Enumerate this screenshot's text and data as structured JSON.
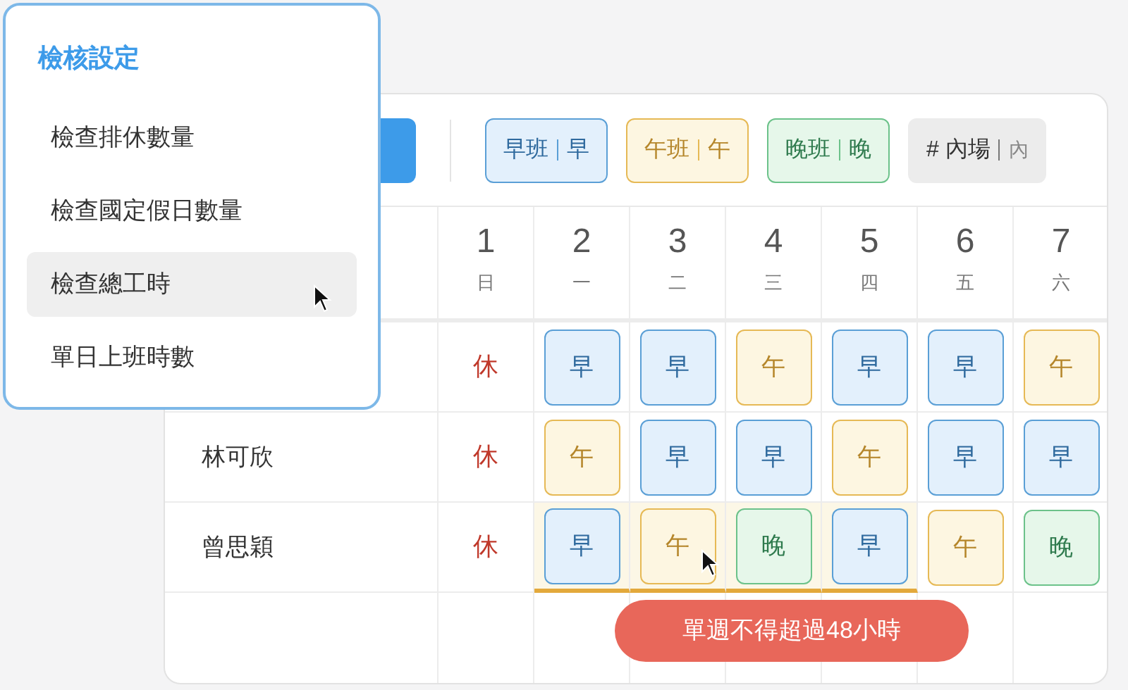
{
  "menu": {
    "title": "檢核設定",
    "items": [
      {
        "label": "檢查排休數量",
        "selected": false
      },
      {
        "label": "檢查國定假日數量",
        "selected": false
      },
      {
        "label": "檢查總工時",
        "selected": true
      },
      {
        "label": "單日上班時數",
        "selected": false
      }
    ]
  },
  "legend": [
    {
      "kind": "early",
      "name": "早班",
      "code": "早"
    },
    {
      "kind": "afternoon",
      "name": "午班",
      "code": "午"
    },
    {
      "kind": "evening",
      "name": "晚班",
      "code": "晚"
    },
    {
      "kind": "area",
      "name": "# 內場",
      "code": "內"
    }
  ],
  "days": [
    {
      "date": "1",
      "weekday": "日"
    },
    {
      "date": "2",
      "weekday": "一"
    },
    {
      "date": "3",
      "weekday": "二"
    },
    {
      "date": "4",
      "weekday": "三"
    },
    {
      "date": "5",
      "weekday": "四"
    },
    {
      "date": "6",
      "weekday": "五"
    },
    {
      "date": "7",
      "weekday": "六"
    }
  ],
  "rows": [
    {
      "cells": [
        {
          "kind": "off",
          "text": "休",
          "flagged": false
        },
        {
          "kind": "early",
          "text": "早",
          "flagged": false
        },
        {
          "kind": "early",
          "text": "早",
          "flagged": false
        },
        {
          "kind": "afternoon",
          "text": "午",
          "flagged": false
        },
        {
          "kind": "early",
          "text": "早",
          "flagged": false
        },
        {
          "kind": "early",
          "text": "早",
          "flagged": false
        },
        {
          "kind": "afternoon",
          "text": "午",
          "flagged": false
        }
      ]
    },
    {
      "name": "林可欣",
      "cells": [
        {
          "kind": "off",
          "text": "休",
          "flagged": false
        },
        {
          "kind": "afternoon",
          "text": "午",
          "flagged": false
        },
        {
          "kind": "early",
          "text": "早",
          "flagged": false
        },
        {
          "kind": "early",
          "text": "早",
          "flagged": false
        },
        {
          "kind": "afternoon",
          "text": "午",
          "flagged": false
        },
        {
          "kind": "early",
          "text": "早",
          "flagged": false
        },
        {
          "kind": "early",
          "text": "早",
          "flagged": false
        }
      ]
    },
    {
      "name": "曾思穎",
      "cells": [
        {
          "kind": "off",
          "text": "休",
          "flagged": false
        },
        {
          "kind": "early",
          "text": "早",
          "flagged": true
        },
        {
          "kind": "afternoon",
          "text": "午",
          "flagged": true
        },
        {
          "kind": "evening",
          "text": "晚",
          "flagged": true
        },
        {
          "kind": "early",
          "text": "早",
          "flagged": true
        },
        {
          "kind": "afternoon",
          "text": "午",
          "flagged": false
        },
        {
          "kind": "evening",
          "text": "晚",
          "flagged": false
        }
      ]
    }
  ],
  "warning": "單週不得超過48小時"
}
